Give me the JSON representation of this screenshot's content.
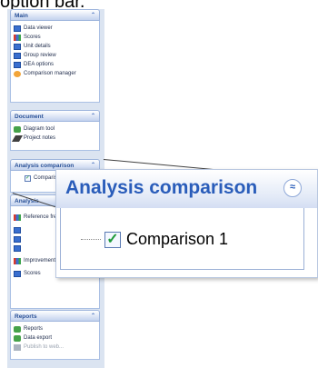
{
  "caption": "option bar.",
  "icons": {
    "chevron_up": "⌃",
    "double_chevron_up": "≈",
    "checkmark": "✓"
  },
  "sidebar": {
    "main": {
      "title": "Main",
      "items": [
        {
          "label": "Data viewer",
          "icon": "grid-icon"
        },
        {
          "label": "Scores",
          "icon": "scores-icon"
        },
        {
          "label": "Unit details",
          "icon": "unit-icon"
        },
        {
          "label": "Group review",
          "icon": "group-icon"
        },
        {
          "label": "DEA options",
          "icon": "options-icon"
        },
        {
          "label": "Comparison manager",
          "icon": "manager-icon"
        }
      ]
    },
    "document": {
      "title": "Document",
      "items": [
        {
          "label": "Diagram tool",
          "icon": "diagram-icon"
        },
        {
          "label": "Project notes",
          "icon": "pen-icon"
        }
      ]
    },
    "analysis": {
      "title": "Analysis comparison",
      "items": [
        {
          "label": "Comparison 1",
          "checked": true
        }
      ]
    },
    "analysis2": {
      "title": "Analysis",
      "items": [
        {
          "label": "Reference frequency"
        },
        {
          "label": ""
        },
        {
          "label": ""
        },
        {
          "label": ""
        },
        {
          "label": "Improvement summary"
        },
        {
          "label": "Scores"
        }
      ]
    },
    "reports": {
      "title": "Reports",
      "items": [
        {
          "label": "Reports",
          "icon": "reports-icon"
        },
        {
          "label": "Data export",
          "icon": "export-icon"
        },
        {
          "label": "Publish to web...",
          "icon": "publish-icon"
        }
      ]
    }
  },
  "zoom": {
    "title": "Analysis comparison",
    "item_label": "Comparison 1"
  }
}
